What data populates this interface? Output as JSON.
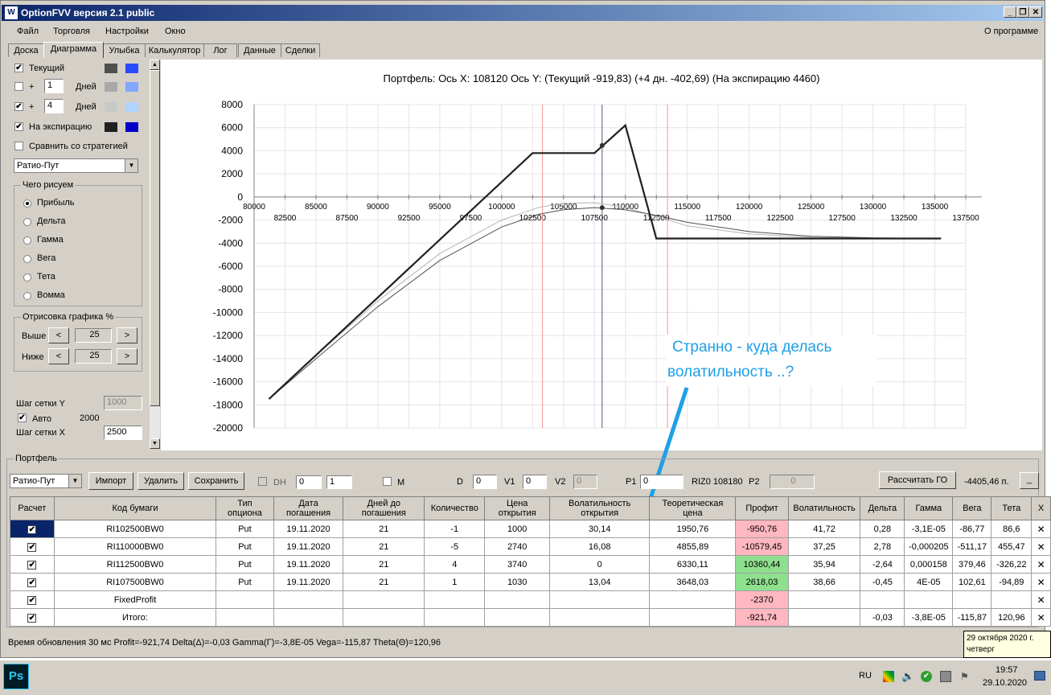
{
  "window": {
    "title": "OptionFVV версия 2.1 public",
    "minimize": "_",
    "restore": "❐",
    "close": "✕"
  },
  "menu": {
    "items": [
      "Файл",
      "Торговля",
      "Настройки",
      "Окно"
    ],
    "about": "О программе"
  },
  "tabs": [
    "Доска",
    "Диаграмма",
    "Улыбка",
    "Калькулятор",
    "Лог",
    "Данные",
    "Сделки"
  ],
  "left": {
    "current_label": "Текущий",
    "plus": "+",
    "days_label": "Дней",
    "days1_value": "1",
    "days2_value": "4",
    "expiry_label": "На экспирацию",
    "compare_label": "Сравнить со стратегией",
    "strategy_value": "Ратио-Пут",
    "what_group": "Чего рисуем",
    "radios": [
      "Прибыль",
      "Дельта",
      "Гамма",
      "Вега",
      "Тета",
      "Вомма"
    ],
    "draw_group": "Отрисовка графика %",
    "above_label": "Выше",
    "above_value": "25",
    "below_label": "Ниже",
    "below_value": "25",
    "prev": "<",
    "next": ">",
    "grid_y_label": "Шаг сетки Y",
    "grid_y_value": "1000",
    "auto_label": "Авто",
    "auto_value": "2000",
    "grid_x_label": "Шаг сетки X",
    "grid_x_value": "2500",
    "colors": {
      "current": [
        "#505050",
        "#2a4cff"
      ],
      "days1": [
        "#a8a8a8",
        "#80a8ff"
      ],
      "days2": [
        "#c8c8c8",
        "#b0d4ff"
      ],
      "expiry": [
        "#202020",
        "#0000c8"
      ]
    }
  },
  "chart_data": {
    "type": "line",
    "title": "Портфель: Ось X: 108120 Ось Y:  (Текущий -919,83)  (+4 дн. -402,69)  (На экспирацию 4460)",
    "xlim": [
      80000,
      137500
    ],
    "ylim": [
      -20000,
      8000
    ],
    "x_ticks_upper": [
      80000,
      85000,
      90000,
      95000,
      100000,
      105000,
      110000,
      115000,
      120000,
      125000,
      130000,
      135000
    ],
    "x_ticks_lower": [
      82500,
      87500,
      92500,
      97500,
      102500,
      107500,
      112500,
      117500,
      122500,
      127500,
      132500,
      137500
    ],
    "y_ticks": [
      8000,
      6000,
      4000,
      2000,
      0,
      -2000,
      -4000,
      -6000,
      -8000,
      -10000,
      -12000,
      -14000,
      -16000,
      -18000,
      -20000
    ],
    "cursor_x": 108120,
    "red_lines": [
      103300,
      113400
    ],
    "series": [
      {
        "key": "expiry",
        "color": "#202020",
        "width": 2.2,
        "points": [
          [
            81200,
            -17500
          ],
          [
            102500,
            3800
          ],
          [
            107500,
            3800
          ],
          [
            110000,
            6200
          ],
          [
            112500,
            -3600
          ],
          [
            135500,
            -3600
          ]
        ]
      },
      {
        "key": "days4",
        "color": "#b4b4b4",
        "width": 1,
        "points": [
          [
            81200,
            -17500
          ],
          [
            85000,
            -13700
          ],
          [
            90000,
            -9000
          ],
          [
            95000,
            -4900
          ],
          [
            100000,
            -2000
          ],
          [
            103000,
            -900
          ],
          [
            105000,
            -550
          ],
          [
            107500,
            -500
          ],
          [
            110000,
            -900
          ],
          [
            112500,
            -1700
          ],
          [
            115000,
            -2500
          ],
          [
            120000,
            -3200
          ],
          [
            125000,
            -3500
          ],
          [
            130000,
            -3600
          ],
          [
            135500,
            -3600
          ]
        ]
      },
      {
        "key": "current",
        "color": "#505050",
        "width": 1,
        "points": [
          [
            81200,
            -17500
          ],
          [
            85000,
            -14000
          ],
          [
            90000,
            -9500
          ],
          [
            95000,
            -5500
          ],
          [
            100000,
            -2600
          ],
          [
            103000,
            -1500
          ],
          [
            105000,
            -1100
          ],
          [
            107500,
            -920
          ],
          [
            110000,
            -1100
          ],
          [
            112500,
            -1600
          ],
          [
            115000,
            -2200
          ],
          [
            120000,
            -3000
          ],
          [
            125000,
            -3400
          ],
          [
            130000,
            -3550
          ],
          [
            135500,
            -3600
          ]
        ]
      }
    ],
    "markers": [
      [
        108120,
        4460
      ],
      [
        108120,
        -920
      ]
    ]
  },
  "callout": {
    "line1": "Странно - куда делась",
    "line2": "волатильность ..?"
  },
  "portfolio": {
    "group_label": "Портфель",
    "strategy_value": "Ратио-Пут",
    "import": "Импорт",
    "delete": "Удалить",
    "save": "Сохранить",
    "dh_label": "DH",
    "dh_v1": "0",
    "dh_v2": "1",
    "m_label": "M",
    "d_label": "D",
    "d_value": "0",
    "v1_label": "V1",
    "v1_value": "0",
    "v2_label": "V2",
    "v2_value": "0",
    "p1_label": "P1",
    "p1_value": "0",
    "riz_label": "RIZ0 108180",
    "p2_label": "P2",
    "p2_value": "0",
    "calc_go": "Рассчитать ГО",
    "go_value": "-4405,46 п.",
    "collapse": "_"
  },
  "table": {
    "headers": [
      "Расчет",
      "Код бумаги",
      "Тип\nопциона",
      "Дата\nпогашения",
      "Дней до\nпогашения",
      "Количество",
      "Цена\nоткрытия",
      "Волатильность\nоткрытия",
      "Теоретическая\nцена",
      "Профит",
      "Волатильность",
      "Дельта",
      "Гамма",
      "Вега",
      "Тета",
      "X"
    ],
    "rows": [
      {
        "code": "RI102500BW0",
        "type": "Put",
        "date": "19.11.2020",
        "days": "21",
        "qty": "-1",
        "price": "1000",
        "vol_open": "30,14",
        "theo": "1950,76",
        "profit": "-950,76",
        "profit_color": "pink",
        "vol": "41,72",
        "delta": "0,28",
        "gamma": "-3,1E-05",
        "vega": "-86,77",
        "theta": "86,6"
      },
      {
        "code": "RI110000BW0",
        "type": "Put",
        "date": "19.11.2020",
        "days": "21",
        "qty": "-5",
        "price": "2740",
        "vol_open": "16,08",
        "theo": "4855,89",
        "profit": "-10579,45",
        "profit_color": "pink",
        "vol": "37,25",
        "delta": "2,78",
        "gamma": "-0,000205",
        "vega": "-511,17",
        "theta": "455,47"
      },
      {
        "code": "RI112500BW0",
        "type": "Put",
        "date": "19.11.2020",
        "days": "21",
        "qty": "4",
        "price": "3740",
        "vol_open": "0",
        "theo": "6330,11",
        "profit": "10360,44",
        "profit_color": "green",
        "vol": "35,94",
        "delta": "-2,64",
        "gamma": "0,000158",
        "vega": "379,46",
        "theta": "-326,22"
      },
      {
        "code": "RI107500BW0",
        "type": "Put",
        "date": "19.11.2020",
        "days": "21",
        "qty": "1",
        "price": "1030",
        "vol_open": "13,04",
        "theo": "3648,03",
        "profit": "2618,03",
        "profit_color": "green",
        "vol": "38,66",
        "delta": "-0,45",
        "gamma": "4E-05",
        "vega": "102,61",
        "theta": "-94,89"
      },
      {
        "code": "FixedProfit",
        "type": "",
        "date": "",
        "days": "",
        "qty": "",
        "price": "",
        "vol_open": "",
        "theo": "",
        "profit": "-2370",
        "profit_color": "pink",
        "vol": "",
        "delta": "",
        "gamma": "",
        "vega": "",
        "theta": ""
      },
      {
        "code": "Итого:",
        "type": "",
        "date": "",
        "days": "",
        "qty": "",
        "price": "",
        "vol_open": "",
        "theo": "",
        "profit": "-921,74",
        "profit_color": "pink",
        "vol": "",
        "delta": "-0,03",
        "gamma": "-3,8E-05",
        "vega": "-115,87",
        "theta": "120,96"
      }
    ],
    "check": "✔",
    "remove": "✕"
  },
  "status": {
    "text": "Время обновления 30 мс  Profit=-921,74 Delta(Δ)=-0,03 Gamma(Γ)=-3,8E-05 Vega=-115,87 Theta(Θ)=120,96"
  },
  "tooltip": {
    "line1": "29 октября 2020 г.",
    "line2": "четверг"
  },
  "taskbar": {
    "app": "Ps",
    "lang": "RU",
    "time": "19:57",
    "date": "29.10.2020"
  }
}
